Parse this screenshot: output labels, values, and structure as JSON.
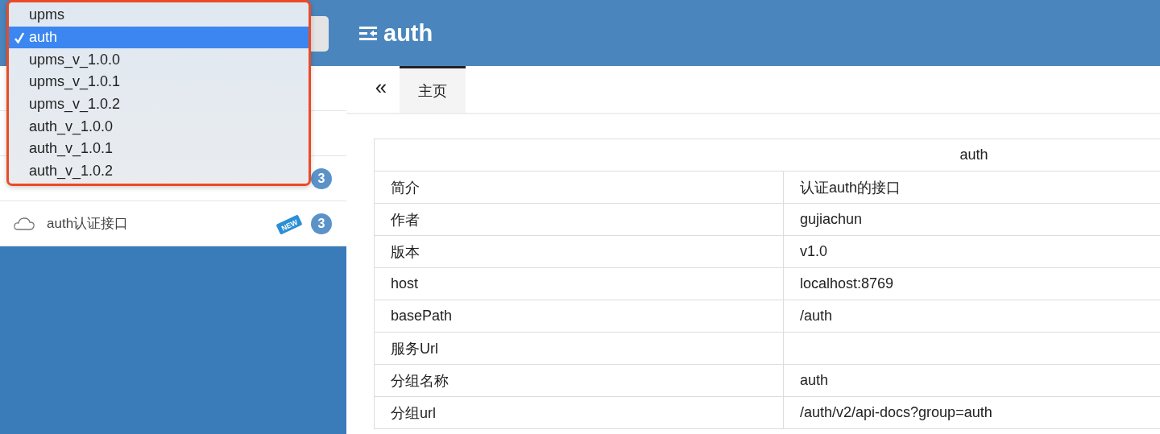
{
  "group_menu": {
    "options": [
      {
        "label": "upms",
        "selected": false
      },
      {
        "label": "auth",
        "selected": true
      },
      {
        "label": "upms_v_1.0.0",
        "selected": false
      },
      {
        "label": "upms_v_1.0.1",
        "selected": false
      },
      {
        "label": "upms_v_1.0.2",
        "selected": false
      },
      {
        "label": "auth_v_1.0.0",
        "selected": false
      },
      {
        "label": "auth_v_1.0.1",
        "selected": false
      },
      {
        "label": "auth_v_1.0.2",
        "selected": false
      }
    ]
  },
  "sidebar": {
    "items": [
      {
        "badge": "3"
      },
      {
        "label": "auth认证接口",
        "new_tag": "NEW",
        "badge": "3"
      }
    ]
  },
  "header": {
    "title": "auth"
  },
  "tabs": [
    {
      "label": "主页",
      "selected": true
    }
  ],
  "collapse_button": "«",
  "table": {
    "title": "auth",
    "rows": [
      [
        "简介",
        "认证auth的接口"
      ],
      [
        "作者",
        "gujiachun"
      ],
      [
        "版本",
        "v1.0"
      ],
      [
        "host",
        "localhost:8769"
      ],
      [
        "basePath",
        "/auth"
      ],
      [
        "服务Url",
        ""
      ],
      [
        "分组名称",
        "auth"
      ],
      [
        "分组url",
        "/auth/v2/api-docs?group=auth"
      ]
    ]
  }
}
